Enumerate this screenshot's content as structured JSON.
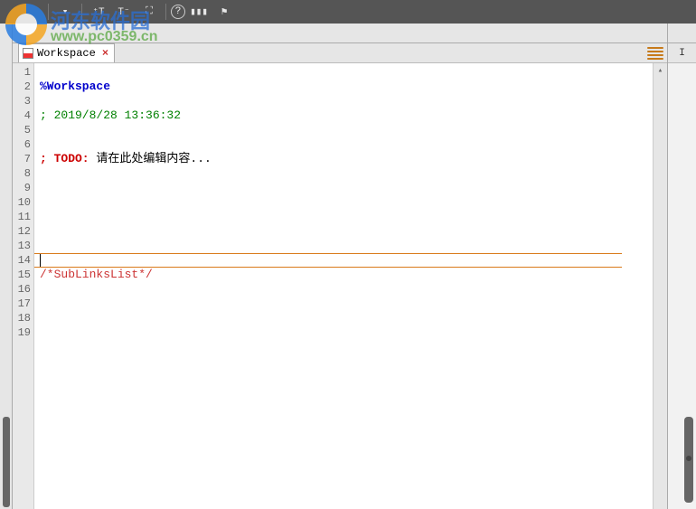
{
  "toolbar": {
    "divider": "▾",
    "font_inc": "⁺T",
    "font_dec": "T⁻",
    "fullscreen": "⛶",
    "help": "?",
    "columns": "▮▮▮",
    "bookmark": "⚑"
  },
  "tab": {
    "title": "Workspace",
    "close": "×"
  },
  "right": {
    "header": "I"
  },
  "editor": {
    "lines": [
      "",
      "%Workspace",
      "",
      "; 2019/8/28 13:36:32",
      "",
      "",
      "; TODO: 请在此处编辑内容...",
      "",
      "",
      "",
      "",
      "",
      "",
      "",
      "/*SubLinksList*/",
      "",
      "",
      "",
      ""
    ],
    "line_numbers": [
      "1",
      "2",
      "3",
      "4",
      "5",
      "6",
      "7",
      "8",
      "9",
      "10",
      "11",
      "12",
      "13",
      "14",
      "15",
      "16",
      "17",
      "18",
      "19"
    ]
  },
  "watermark": {
    "title": "河东软件园",
    "url": "www.pc0359.cn"
  },
  "chart_data": null
}
